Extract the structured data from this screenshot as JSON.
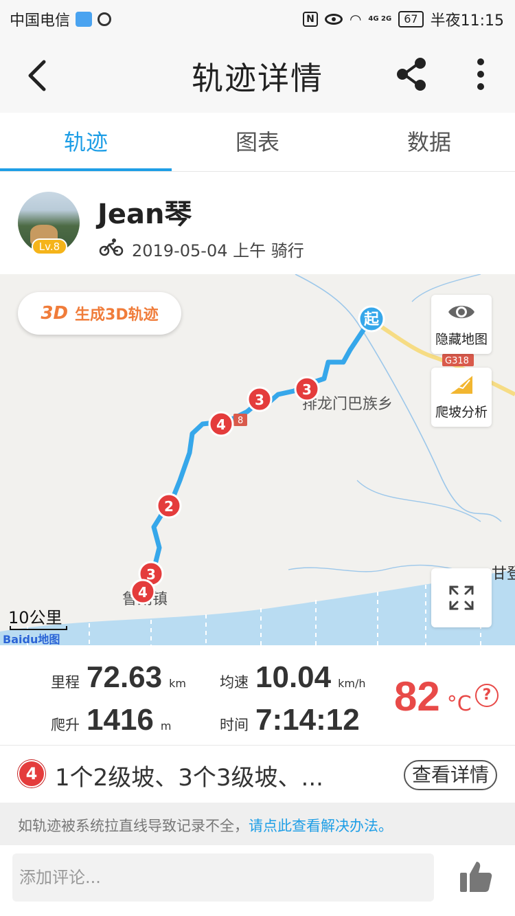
{
  "status_bar": {
    "carrier": "中国电信",
    "battery": "67",
    "time": "半夜11:15",
    "network": "4G 2G"
  },
  "header": {
    "title": "轨迹详情",
    "icons": [
      "back-arrow-icon",
      "share-icon",
      "more-vertical-icon"
    ]
  },
  "tabs": [
    {
      "label": "轨迹",
      "active": true
    },
    {
      "label": "图表",
      "active": false
    },
    {
      "label": "数据",
      "active": false
    }
  ],
  "user": {
    "name": "Jean琴",
    "level": "Lv.8",
    "ride_info": "2019-05-04 上午 骑行"
  },
  "map": {
    "btn_3d_logo": "3D",
    "btn_3d_label": "生成3D轨迹",
    "hide_map_label": "隐藏地图",
    "climb_label": "爬坡分析",
    "start_marker": "起",
    "road_label": "G318",
    "road_label_short": "8",
    "town_label": "排龙门巴族乡",
    "town2_label": "鲁朗镇",
    "gan_label": "甘登",
    "scale": "10公里",
    "logo": "Bai",
    "logo_du": "du",
    "logo_map": "地图",
    "climb_markers": [
      "3",
      "3",
      "4",
      "2",
      "3",
      "4"
    ],
    "route_color": "#36a7ea"
  },
  "stats": {
    "distance_label": "里程",
    "distance_value": "72.63",
    "distance_unit": "km",
    "speed_label": "均速",
    "speed_value": "10.04",
    "speed_unit": "km/h",
    "climb_label": "爬升",
    "climb_value": "1416",
    "climb_unit": "m",
    "time_label": "时间",
    "time_value": "7:14:12",
    "temp_value": "82",
    "temp_unit": "°C",
    "help": "?"
  },
  "climbs": {
    "badge": "4",
    "summary": "1个2级坡、3个3级坡、...",
    "detail_button": "查看详情"
  },
  "notice": {
    "text": "如轨迹被系统拉直线导致记录不全，",
    "link": "请点此查看解决办法",
    "end": "。"
  },
  "comment": {
    "placeholder": "添加评论..."
  },
  "colors": {
    "accent": "#1e9ee6",
    "temp_red": "#e84a48",
    "climb_red": "#e43c3c",
    "orange": "#f07c3a"
  }
}
